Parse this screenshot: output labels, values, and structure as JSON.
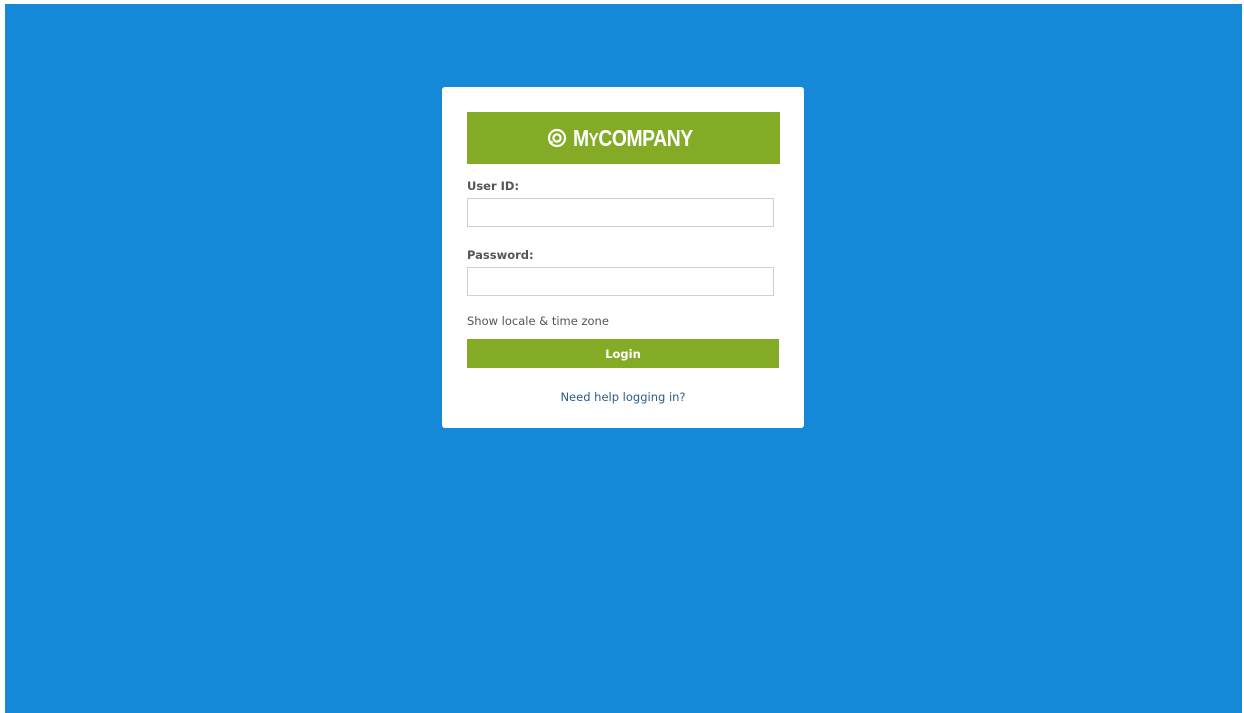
{
  "brand": {
    "name_prefix": "M",
    "name_small": "Y",
    "name_suffix": "COMPANY",
    "logo_icon": "target-icon",
    "banner_color": "#84ab25"
  },
  "form": {
    "user_id_label": "User ID:",
    "user_id_value": "",
    "password_label": "Password:",
    "password_value": "",
    "locale_link": "Show locale & time zone",
    "login_button": "Login",
    "help_link": "Need help logging in?"
  },
  "colors": {
    "background": "#1588d8",
    "accent": "#84ab25",
    "link": "#2a5d8a"
  }
}
